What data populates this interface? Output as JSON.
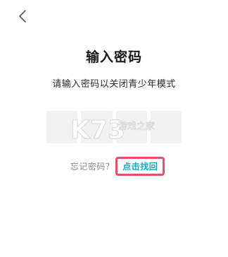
{
  "header": {
    "back_icon": "chevron-left-icon"
  },
  "main": {
    "title": "输入密码",
    "subtitle": "请输入密码以关闭青少年模式",
    "pin_box_count": 4
  },
  "watermark": {
    "logo_text": "K73",
    "site_text": "游戏之家"
  },
  "forgot": {
    "label": "忘记密码？",
    "link": "点击找回"
  },
  "colors": {
    "link": "#14a9c9",
    "highlight_border": "#e8506a",
    "pin_box": "#f2f2f2"
  }
}
